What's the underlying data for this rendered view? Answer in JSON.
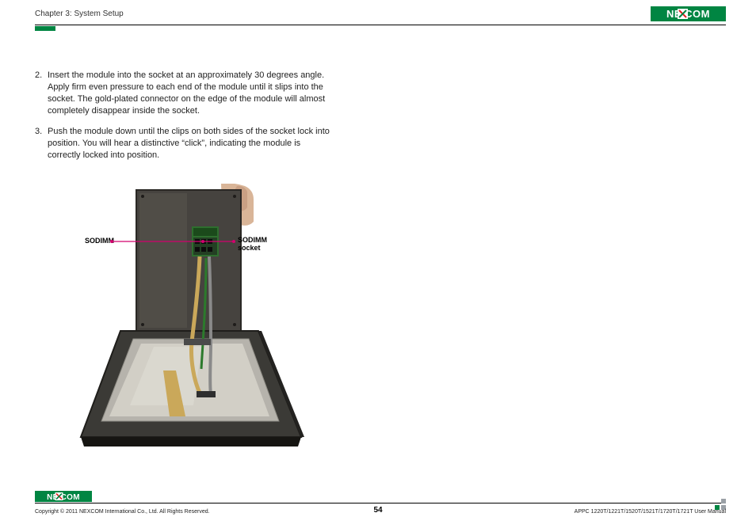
{
  "header": {
    "chapter": "Chapter 3: System Setup",
    "logo_text": "NEXCOM"
  },
  "steps": [
    {
      "num": "2.",
      "text": "Insert the module into the socket at an approximately 30 degrees angle. Apply firm even pressure to each end of the module until it slips into the socket. The gold-plated connector on the edge of the module will almost completely disappear inside the socket."
    },
    {
      "num": "3.",
      "text": "Push the module down until the clips on both sides of the socket lock into position. You will hear a distinctive “click”, indicating the module is correctly locked into position."
    }
  ],
  "callouts": {
    "left": "SODIMM",
    "right_line1": "SODIMM",
    "right_line2": "socket"
  },
  "footer": {
    "logo_text": "NEXCOM",
    "copyright": "Copyright © 2011 NEXCOM International Co., Ltd. All Rights Reserved.",
    "page": "54",
    "model": "APPC 1220T/1221T/1520T/1521T/1720T/1721T User Manual"
  }
}
